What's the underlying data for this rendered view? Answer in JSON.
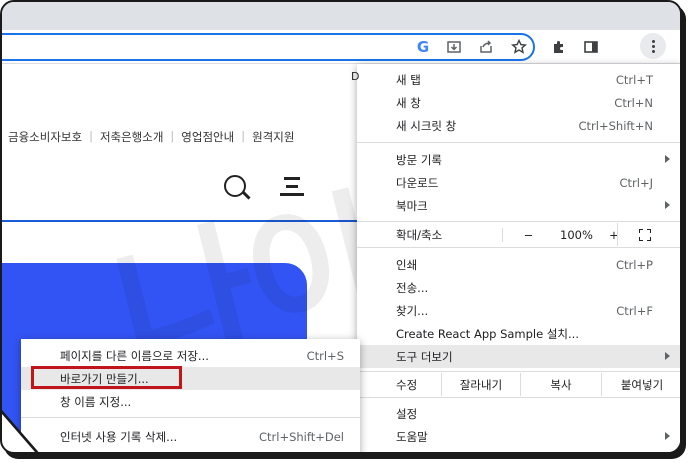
{
  "browser": {
    "toolbar_icons": [
      "google-icon",
      "install-icon",
      "share-icon",
      "bookmark-star-icon",
      "extensions-icon",
      "side-panel-icon",
      "more-menu-icon"
    ],
    "google_glyph": "G",
    "accent_color": "#1a73e8"
  },
  "page": {
    "nav_links": [
      "금융소비자보호",
      "저축은행소개",
      "영업점안내",
      "원격지원"
    ],
    "top_right_fragment": "D",
    "hero_color": "#3354f4",
    "rule_color": "#1a5bd6"
  },
  "watermark": "나이원",
  "chrome_menu": {
    "items_top": [
      {
        "label": "새 탭",
        "shortcut": "Ctrl+T"
      },
      {
        "label": "새 창",
        "shortcut": "Ctrl+N"
      },
      {
        "label": "새 시크릿 창",
        "shortcut": "Ctrl+Shift+N"
      }
    ],
    "items_history": [
      {
        "label": "방문 기록",
        "shortcut": ""
      },
      {
        "label": "다운로드",
        "shortcut": "Ctrl+J"
      },
      {
        "label": "북마크",
        "shortcut": ""
      }
    ],
    "zoom": {
      "label": "확대/축소",
      "minus": "−",
      "value": "100%",
      "plus": "+"
    },
    "items_tools": [
      {
        "label": "인쇄",
        "shortcut": "Ctrl+P"
      },
      {
        "label": "전송...",
        "shortcut": ""
      },
      {
        "label": "찾기...",
        "shortcut": "Ctrl+F"
      },
      {
        "label": "Create React App Sample 설치...",
        "shortcut": ""
      },
      {
        "label": "도구 더보기",
        "shortcut": ""
      }
    ],
    "edit": {
      "label": "수정",
      "cut": "잘라내기",
      "copy": "복사",
      "paste": "붙여넣기"
    },
    "items_bottom": [
      {
        "label": "설정",
        "shortcut": ""
      },
      {
        "label": "도움말",
        "shortcut": ""
      }
    ]
  },
  "submenu": {
    "items": [
      {
        "label": "페이지를 다른 이름으로 저장...",
        "shortcut": "Ctrl+S"
      },
      {
        "label": "바로가기 만들기...",
        "shortcut": ""
      },
      {
        "label": "창 이름 지정...",
        "shortcut": ""
      },
      {
        "label": "인터넷 사용 기록 삭제...",
        "shortcut": "Ctrl+Shift+Del"
      }
    ],
    "highlight_color": "#c0161b"
  }
}
